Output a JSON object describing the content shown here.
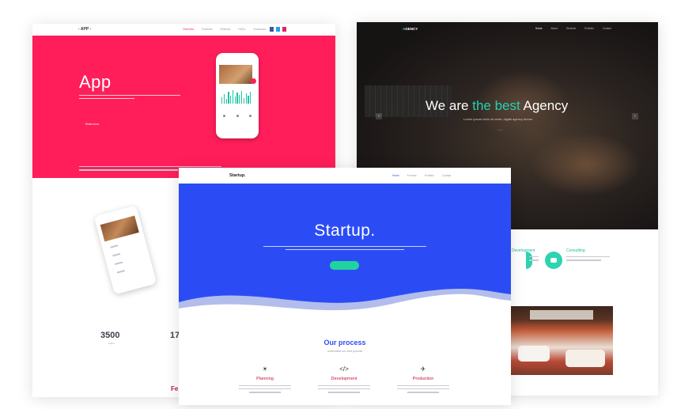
{
  "app": {
    "logo": "APP",
    "nav": [
      "Overview",
      "Features",
      "Reviews",
      "FAQ's",
      "Download"
    ],
    "hero_title": "App",
    "hero_button": "Read more",
    "stat_value": "3500",
    "stat_label": "Users",
    "stat_value_2": "17",
    "features_fragment": "Fe"
  },
  "agency": {
    "logo_accent": "A",
    "logo_rest": "GENCY",
    "nav": [
      "Home",
      "About",
      "Services",
      "Portfolio",
      "Contact"
    ],
    "hero_title_prefix": "We are ",
    "hero_title_highlight": "the best",
    "hero_title_suffix": " Agency",
    "hero_subtitle": "Lorem ipsum dolor sit amet, digital agency theme.",
    "services": [
      "Development",
      "Consulting"
    ],
    "arrow_left": "‹",
    "arrow_right": "›"
  },
  "startup": {
    "logo": "Startup",
    "logo_dot": ".",
    "nav": [
      "Home",
      "Process",
      "Portfolio",
      "Contact"
    ],
    "hero_title": "Startup.",
    "process_title": "Our process",
    "process_subtitle": "Understand our work process",
    "steps": [
      {
        "name": "Planning",
        "icon": "lightbulb-icon",
        "glyph": "☀"
      },
      {
        "name": "Development",
        "icon": "code-icon",
        "glyph": "</>"
      },
      {
        "name": "Production",
        "icon": "rocket-icon",
        "glyph": "✈"
      }
    ]
  },
  "colors": {
    "app_accent": "#ff1e5a",
    "agency_accent": "#22d1b3",
    "startup_accent": "#2b4cf5",
    "startup_button": "#21d39e"
  }
}
